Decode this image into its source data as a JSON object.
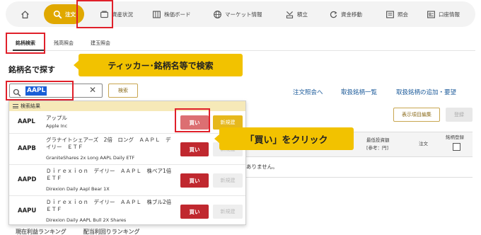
{
  "nav": {
    "items": [
      {
        "label": "",
        "icon": "home-icon"
      },
      {
        "label": "注文",
        "icon": "search-icon"
      },
      {
        "label": "資産状況",
        "icon": "wallet-icon"
      },
      {
        "label": "株価ボード",
        "icon": "board-icon"
      },
      {
        "label": "マーケット情報",
        "icon": "globe-icon"
      },
      {
        "label": "積立",
        "icon": "savings-icon"
      },
      {
        "label": "資金移動",
        "icon": "transfer-icon"
      },
      {
        "label": "照会",
        "icon": "inquiry-icon"
      },
      {
        "label": "口座情報",
        "icon": "account-icon"
      }
    ]
  },
  "subtabs": [
    "銘柄検索",
    "残高照会",
    "建玉照会"
  ],
  "page_title": "銘柄名で探す",
  "callouts": {
    "search": "ティッカー･銘柄名等で検索",
    "buy": "「買い」をクリック"
  },
  "search": {
    "value": "AAPL",
    "clear": "✕",
    "button": "検索"
  },
  "links": [
    "注文照会へ",
    "取扱銘柄一覧",
    "取扱銘柄の追加・要望"
  ],
  "results": {
    "header": "検索結果",
    "rows": [
      {
        "ticker": "AAPL",
        "name": "アップル",
        "ename": "Apple Inc",
        "buy": "買い",
        "new": "新規建"
      },
      {
        "ticker": "AAPB",
        "name": "グラナイトシェアーズ　2倍　ロング　ＡＡＰＬ　デイリー　ＥＴＦ",
        "ename": "GraniteShares 2x Long AAPL Daily ETF",
        "buy": "買い",
        "new": "新規建"
      },
      {
        "ticker": "AAPD",
        "name": "Ｄｉｒｅｘｉｏｎ　デイリー　ＡＡＰＬ　株ベア1倍　ＥＴＦ",
        "ename": "Direxion Daily Aapl Bear 1X",
        "buy": "買い",
        "new": "新規建"
      },
      {
        "ticker": "AAPU",
        "name": "Ｄｉｒｅｘｉｏｎ　デイリー　ＡＡＰＬ　株ブル2倍　ＥＴＦ",
        "ename": "Direxion Daily AAPL Bull 2X Shares",
        "buy": "買い",
        "new": "新規建"
      }
    ]
  },
  "right": {
    "display_button": "表示項目編集",
    "register_button": "登録",
    "col_min_invest": "最低投資額",
    "col_min_invest_unit": "[参考：円]",
    "col_order": "注文",
    "col_register": "銘柄登録",
    "empty_message": "ありません。"
  },
  "bottom_text": "現在利益ランキング　　　配当利回りランキング",
  "colors": {
    "accent": "#e0a800",
    "buy": "#c0282f",
    "highlight": "#e0202a",
    "callout": "#f2c200"
  }
}
